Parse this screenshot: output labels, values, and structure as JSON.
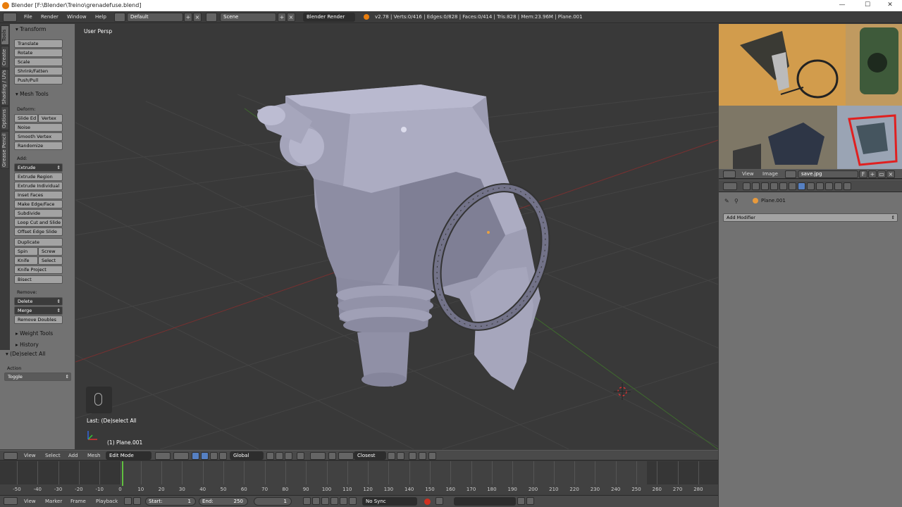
{
  "window": {
    "title": "Blender [F:\\Blender\\Treino\\grenadefuse.blend]",
    "minimize": "—",
    "maximize": "☐",
    "close": "✕"
  },
  "menu": {
    "items": [
      "File",
      "Render",
      "Window",
      "Help"
    ],
    "layout": "Default",
    "scene": "Scene",
    "engine": "Blender Render",
    "stats": "v2.78 | Verts:0/416 | Edges:0/828 | Faces:0/414 | Tris:828 | Mem:23.96M | Plane.001"
  },
  "tabs": [
    "Tools",
    "Create",
    "Shading / UVs",
    "Options",
    "Grease Pencil"
  ],
  "toolshelf": {
    "transform_header": "Transform",
    "transform": [
      "Translate",
      "Rotate",
      "Scale",
      "Shrink/Fatten",
      "Push/Pull"
    ],
    "mesh_tools_header": "Mesh Tools",
    "deform_label": "Deform:",
    "slide_edge": "Slide Ed",
    "vertex": "Vertex",
    "noise": "Noise",
    "smooth_vertex": "Smooth Vertex",
    "randomize": "Randomize",
    "add_label": "Add:",
    "extrude": "Extrude",
    "add_items": [
      "Extrude Region",
      "Extrude Individual",
      "Inset Faces",
      "Make Edge/Face",
      "Subdivide",
      "Loop Cut and Slide",
      "Offset Edge Slide",
      "Duplicate"
    ],
    "spin": "Spin",
    "screw": "Screw",
    "knife": "Knife",
    "select": "Select",
    "knife_project": "Knife Project",
    "bisect": "Bisect",
    "remove_label": "Remove:",
    "delete": "Delete",
    "merge": "Merge",
    "remove_doubles": "Remove Doubles",
    "weight_tools": "Weight Tools",
    "history": "History"
  },
  "operator": {
    "title": "(De)select All",
    "action_label": "Action",
    "action_value": "Toggle"
  },
  "viewport": {
    "label": "User Persp",
    "last_op": "Last: (De)select All",
    "object": "(1) Plane.001"
  },
  "view3d_header": {
    "menus": [
      "View",
      "Select",
      "Add",
      "Mesh"
    ],
    "mode": "Edit Mode",
    "orientation": "Global",
    "snap": "Closest"
  },
  "image_editor": {
    "menus": [
      "View",
      "Image"
    ],
    "image_name": "save.jpg",
    "fake_user": "F"
  },
  "properties": {
    "object_name": "Plane.001",
    "add_modifier": "Add Modifier"
  },
  "timeline": {
    "ticks": [
      "-50",
      "-40",
      "-30",
      "-20",
      "-10",
      "0",
      "10",
      "20",
      "30",
      "40",
      "50",
      "60",
      "70",
      "80",
      "90",
      "100",
      "110",
      "120",
      "130",
      "140",
      "150",
      "160",
      "170",
      "180",
      "190",
      "200",
      "210",
      "220",
      "230",
      "240",
      "250",
      "260",
      "270",
      "280"
    ],
    "menus": [
      "View",
      "Marker",
      "Frame",
      "Playback"
    ],
    "start_label": "Start:",
    "start_value": "1",
    "end_label": "End:",
    "end_value": "250",
    "current": "1",
    "sync": "No Sync",
    "current_frame": 1
  },
  "colors": {
    "accent": "#5680c2",
    "selected_button": "#3b3b3b",
    "frame_marker": "#60c040",
    "record": "#d03020"
  }
}
